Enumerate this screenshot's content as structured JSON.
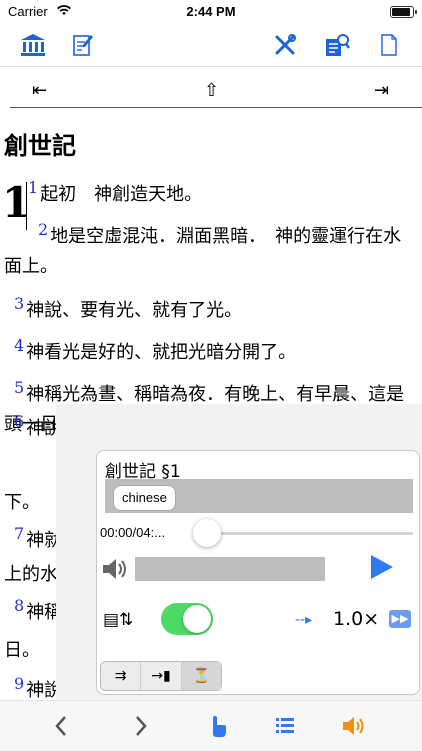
{
  "status": {
    "carrier": "Carrier",
    "time": "2:44 PM",
    "battery_level": 0.9
  },
  "toolbar": {
    "icons": [
      "library-icon",
      "edit-note-icon",
      "tools-icon",
      "search-document-icon",
      "page-icon"
    ]
  },
  "nav": {
    "prev": "⇤",
    "up": "⇧",
    "next": "⇥"
  },
  "book": {
    "title": "創世記",
    "chapter": "1"
  },
  "verses": [
    {
      "num": "1",
      "text": "起初　神創造天地。"
    },
    {
      "num": "2",
      "text": "地是空虛混沌．淵面黑暗．　神的靈運行在水面上。"
    },
    {
      "num": "3",
      "text": "神說、要有光、就有了光。"
    },
    {
      "num": "4",
      "text": "神看光是好的、就把光暗分開了。"
    },
    {
      "num": "5",
      "text": "神稱光為晝、稱暗為夜．有晚上、有早晨、這是頭一日。"
    },
    {
      "num": "6",
      "text": "神說、"
    },
    {
      "num": "",
      "text": "下。"
    },
    {
      "num": "7",
      "text": "神就造"
    },
    {
      "num": "",
      "text": "上的水分開"
    },
    {
      "num": "8",
      "text": "神稱空"
    },
    {
      "num": "",
      "text": "日。"
    },
    {
      "num": "9",
      "text": "神說、"
    }
  ],
  "player": {
    "title": "創世記 §1",
    "language_chip": "chinese",
    "time_display": "00:00/04:...",
    "progress": 0.0,
    "autoplay_on": true,
    "speed": "1.0×",
    "seg_items": [
      "⇉",
      "→▮",
      "⏳"
    ],
    "accent_color": "#2e7bf0",
    "switch_color": "#4cd964"
  },
  "bottom": {
    "icons": [
      "chevron-left-icon",
      "chevron-right-icon",
      "tap-hand-icon",
      "list-icon",
      "speaker-icon"
    ]
  }
}
